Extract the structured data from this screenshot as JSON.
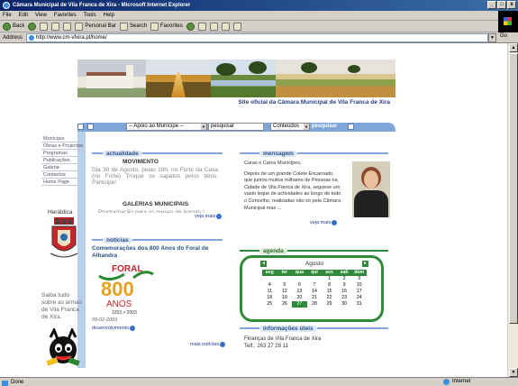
{
  "window": {
    "title": "Câmara Municipal de Vila Franca de Xira - Microsoft Internet Explorer",
    "controls": [
      "_",
      "□",
      "x"
    ]
  },
  "menu": [
    "File",
    "Edit",
    "View",
    "Favorites",
    "Tools",
    "Help"
  ],
  "toolbar": {
    "back": "Back",
    "personal_bar": "Personal Bar",
    "search": "Search",
    "favorites": "Favorites"
  },
  "address": {
    "label": "Address",
    "url": "http://www.cm-vfxira.pt/home/",
    "go": "Go"
  },
  "status": {
    "left": "Done",
    "zone": "Internet"
  },
  "page": {
    "site_title": "Site oficial da Câmara Municipal de Vila Franca de Xira",
    "search": {
      "select_value": "-- Apoio ao Munícipe --",
      "input_value": "pesquisar",
      "content_select": "Conteúdos",
      "button": "pesquisar"
    },
    "nav": [
      "Munícipio",
      "Obras e Projectos",
      "Programas",
      "Publicações",
      "Galeria",
      "Contactos",
      "Home Page"
    ],
    "heraldica": "Heráldica",
    "saiba": "Saiba tudo sobre as armas de Vila Franca de Xira.",
    "actualidade": {
      "label": "actualidade",
      "title": "MOVIMENTO",
      "body": "Dia 30 de Agosto, pelas 18h, no Forte da Casa (no Forte) Troque os sapatos pelos ténis. Participe!",
      "title2": "GALERIAS MUNICIPAIS",
      "body2": "Programação para os meses de Agosto /...",
      "more": "veja mais"
    },
    "mensagem": {
      "label": "mensagem",
      "greeting": "Caras e Caros Munícipes,",
      "body": "Depois de um grande Colete Encarnado, que juntou muitos milhares de Pessoas na Cidade de Vila Franca de Xira, seguese um vasto leque de actividades ao longo de todo o Concelho, realizadas não só pela Câmara Municipal mas ...",
      "more": "veja mais"
    },
    "noticias": {
      "label": "notícias",
      "title": "Comemorações dos 800 Anos do Foral de Alhandra",
      "foral_word": "FORAL",
      "foral_number": "800",
      "foral_anos": "ANOS",
      "foral_years": "1203 » 2003",
      "date": "09-02-2003",
      "link": "desenvolvimento",
      "more": "mais notícias"
    },
    "agenda": {
      "label": "agenda",
      "month": "Agosto",
      "prev": "◄",
      "next": "►",
      "days": [
        "seg",
        "ter",
        "qua",
        "qui",
        "sex",
        "sab",
        "dom"
      ],
      "dates": [
        "",
        "",
        "",
        "",
        "1",
        "2",
        "3",
        "4",
        "5",
        "6",
        "7",
        "8",
        "9",
        "10",
        "11",
        "12",
        "13",
        "14",
        "15",
        "16",
        "17",
        "18",
        "19",
        "20",
        "21",
        "22",
        "23",
        "24",
        "25",
        "26",
        "27",
        "28",
        "29",
        "30",
        "31"
      ],
      "today": "27"
    },
    "info": {
      "label": "informações úteis",
      "line1": "Finanças de Vila Franca de Xira",
      "line2": "Telf.: 263 27 28 11"
    }
  }
}
